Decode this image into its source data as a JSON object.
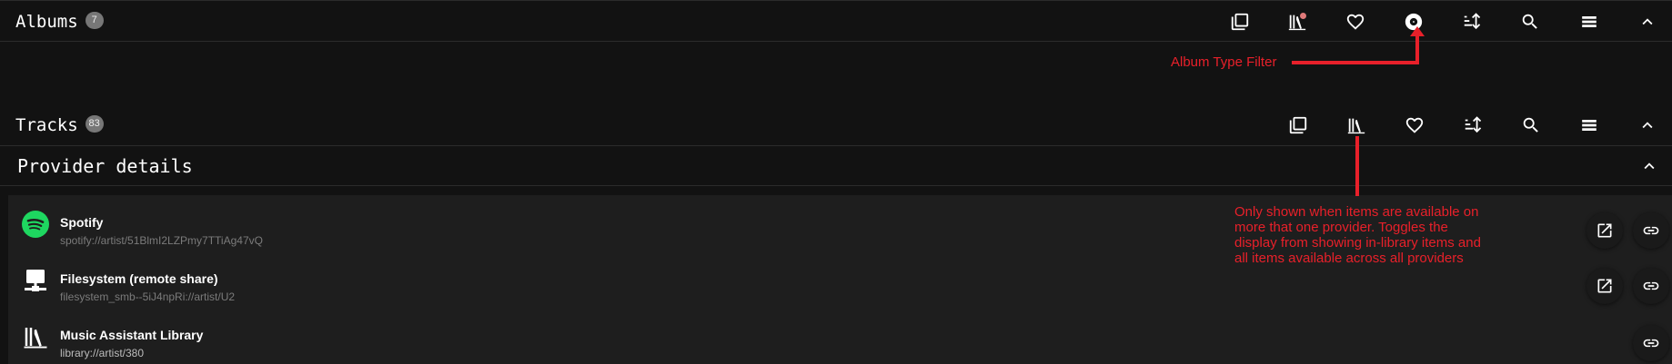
{
  "albums": {
    "title": "Albums",
    "count": "7"
  },
  "tracks": {
    "title": "Tracks",
    "count": "83"
  },
  "provider_details": {
    "title": "Provider details"
  },
  "providers": [
    {
      "name": "Spotify",
      "uri": "spotify://artist/51BlmI2LZPmy7TTiAg47vQ"
    },
    {
      "name": "Filesystem (remote share)",
      "uri": "filesystem_smb--5iJ4npRi://artist/U2"
    },
    {
      "name": "Music Assistant Library",
      "uri": "library://artist/380"
    }
  ],
  "annotations": {
    "album_type_filter": "Album Type Filter",
    "library_toggle": "Only shown when items are available on more that one provider. Toggles the display from showing in-library items and all items available across all providers"
  },
  "colors": {
    "background": "#121212",
    "annotation": "#e8202a",
    "spotify": "#1ed760",
    "badge": "#777777"
  }
}
